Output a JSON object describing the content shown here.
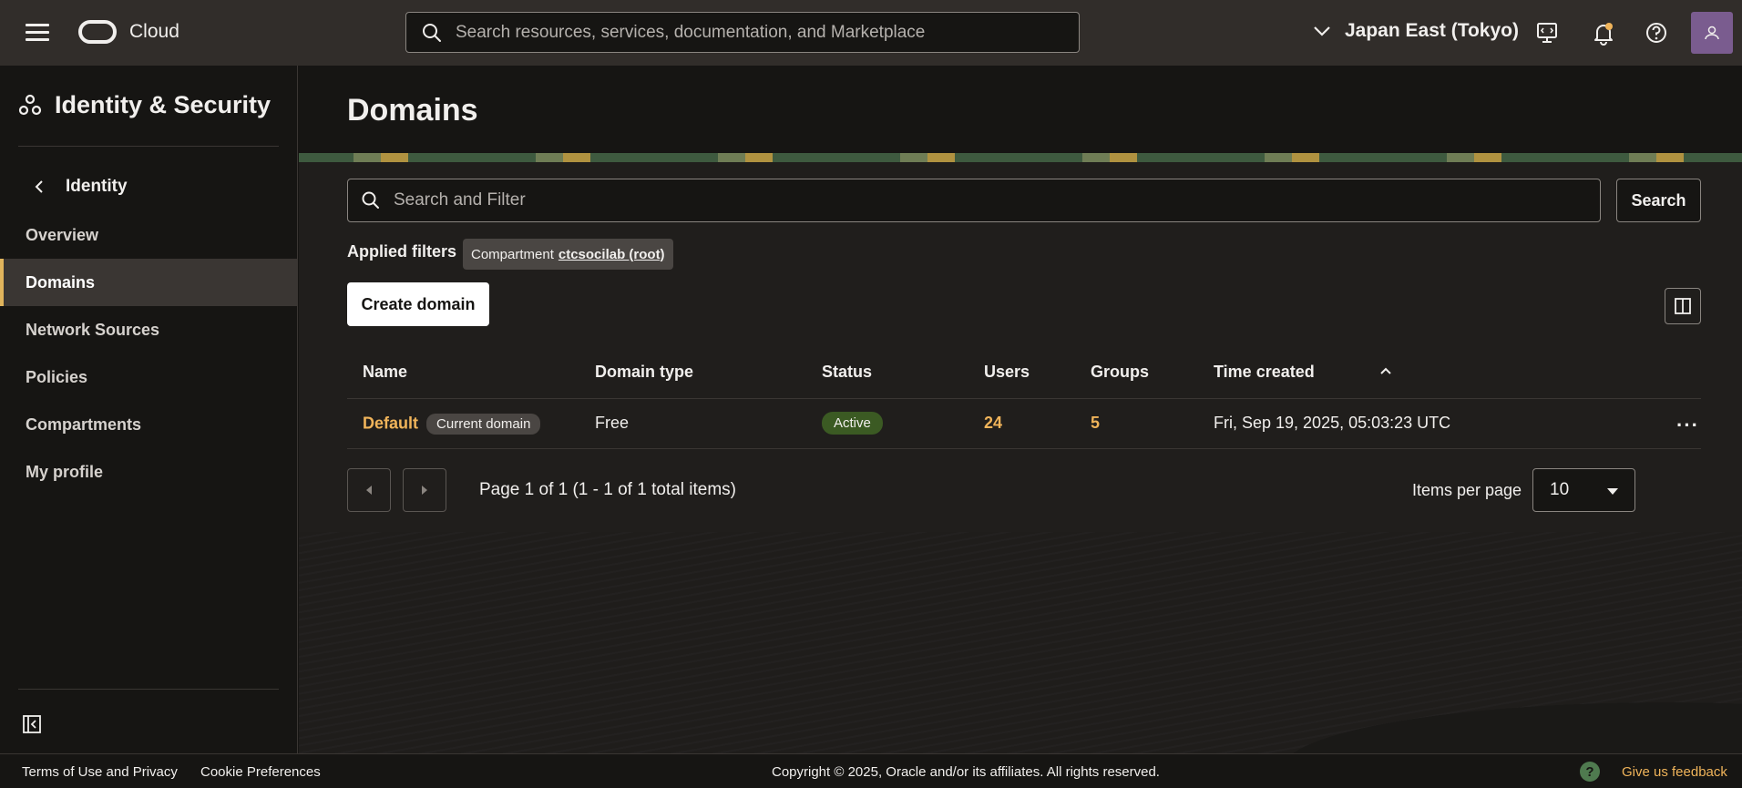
{
  "header": {
    "brand": "Cloud",
    "search_placeholder": "Search resources, services, documentation, and Marketplace",
    "region": "Japan East (Tokyo)"
  },
  "sidebar": {
    "title": "Identity & Security",
    "back_label": "Identity",
    "items": [
      {
        "label": "Overview"
      },
      {
        "label": "Domains",
        "active": true
      },
      {
        "label": "Network Sources"
      },
      {
        "label": "Policies"
      },
      {
        "label": "Compartments"
      },
      {
        "label": "My profile"
      }
    ]
  },
  "main": {
    "title": "Domains",
    "filter_placeholder": "Search and Filter",
    "search_button": "Search",
    "applied_filters_label": "Applied filters",
    "filter_chip": {
      "label": "Compartment",
      "value": "ctcsocilab (root)"
    },
    "create_button": "Create domain",
    "table": {
      "columns": [
        "Name",
        "Domain type",
        "Status",
        "Users",
        "Groups",
        "Time created"
      ],
      "rows": [
        {
          "name": "Default",
          "badge": "Current domain",
          "domain_type": "Free",
          "status": "Active",
          "users": "24",
          "groups": "5",
          "time_created": "Fri, Sep 19, 2025, 05:03:23 UTC"
        }
      ]
    },
    "pagination": {
      "text": "Page 1 of 1 (1 - 1 of 1 total items)",
      "items_per_page_label": "Items per page",
      "items_per_page_value": "10"
    }
  },
  "footer": {
    "terms": "Terms of Use and Privacy",
    "cookies": "Cookie Preferences",
    "copyright": "Copyright © 2025, Oracle and/or its affiliates. All rights reserved.",
    "feedback": "Give us feedback",
    "help_glyph": "?"
  },
  "colors": {
    "accent_link": "#f0b45a",
    "active_badge": "#3b5a23",
    "topbar": "#312d2a",
    "avatar": "#7a5c8f"
  }
}
